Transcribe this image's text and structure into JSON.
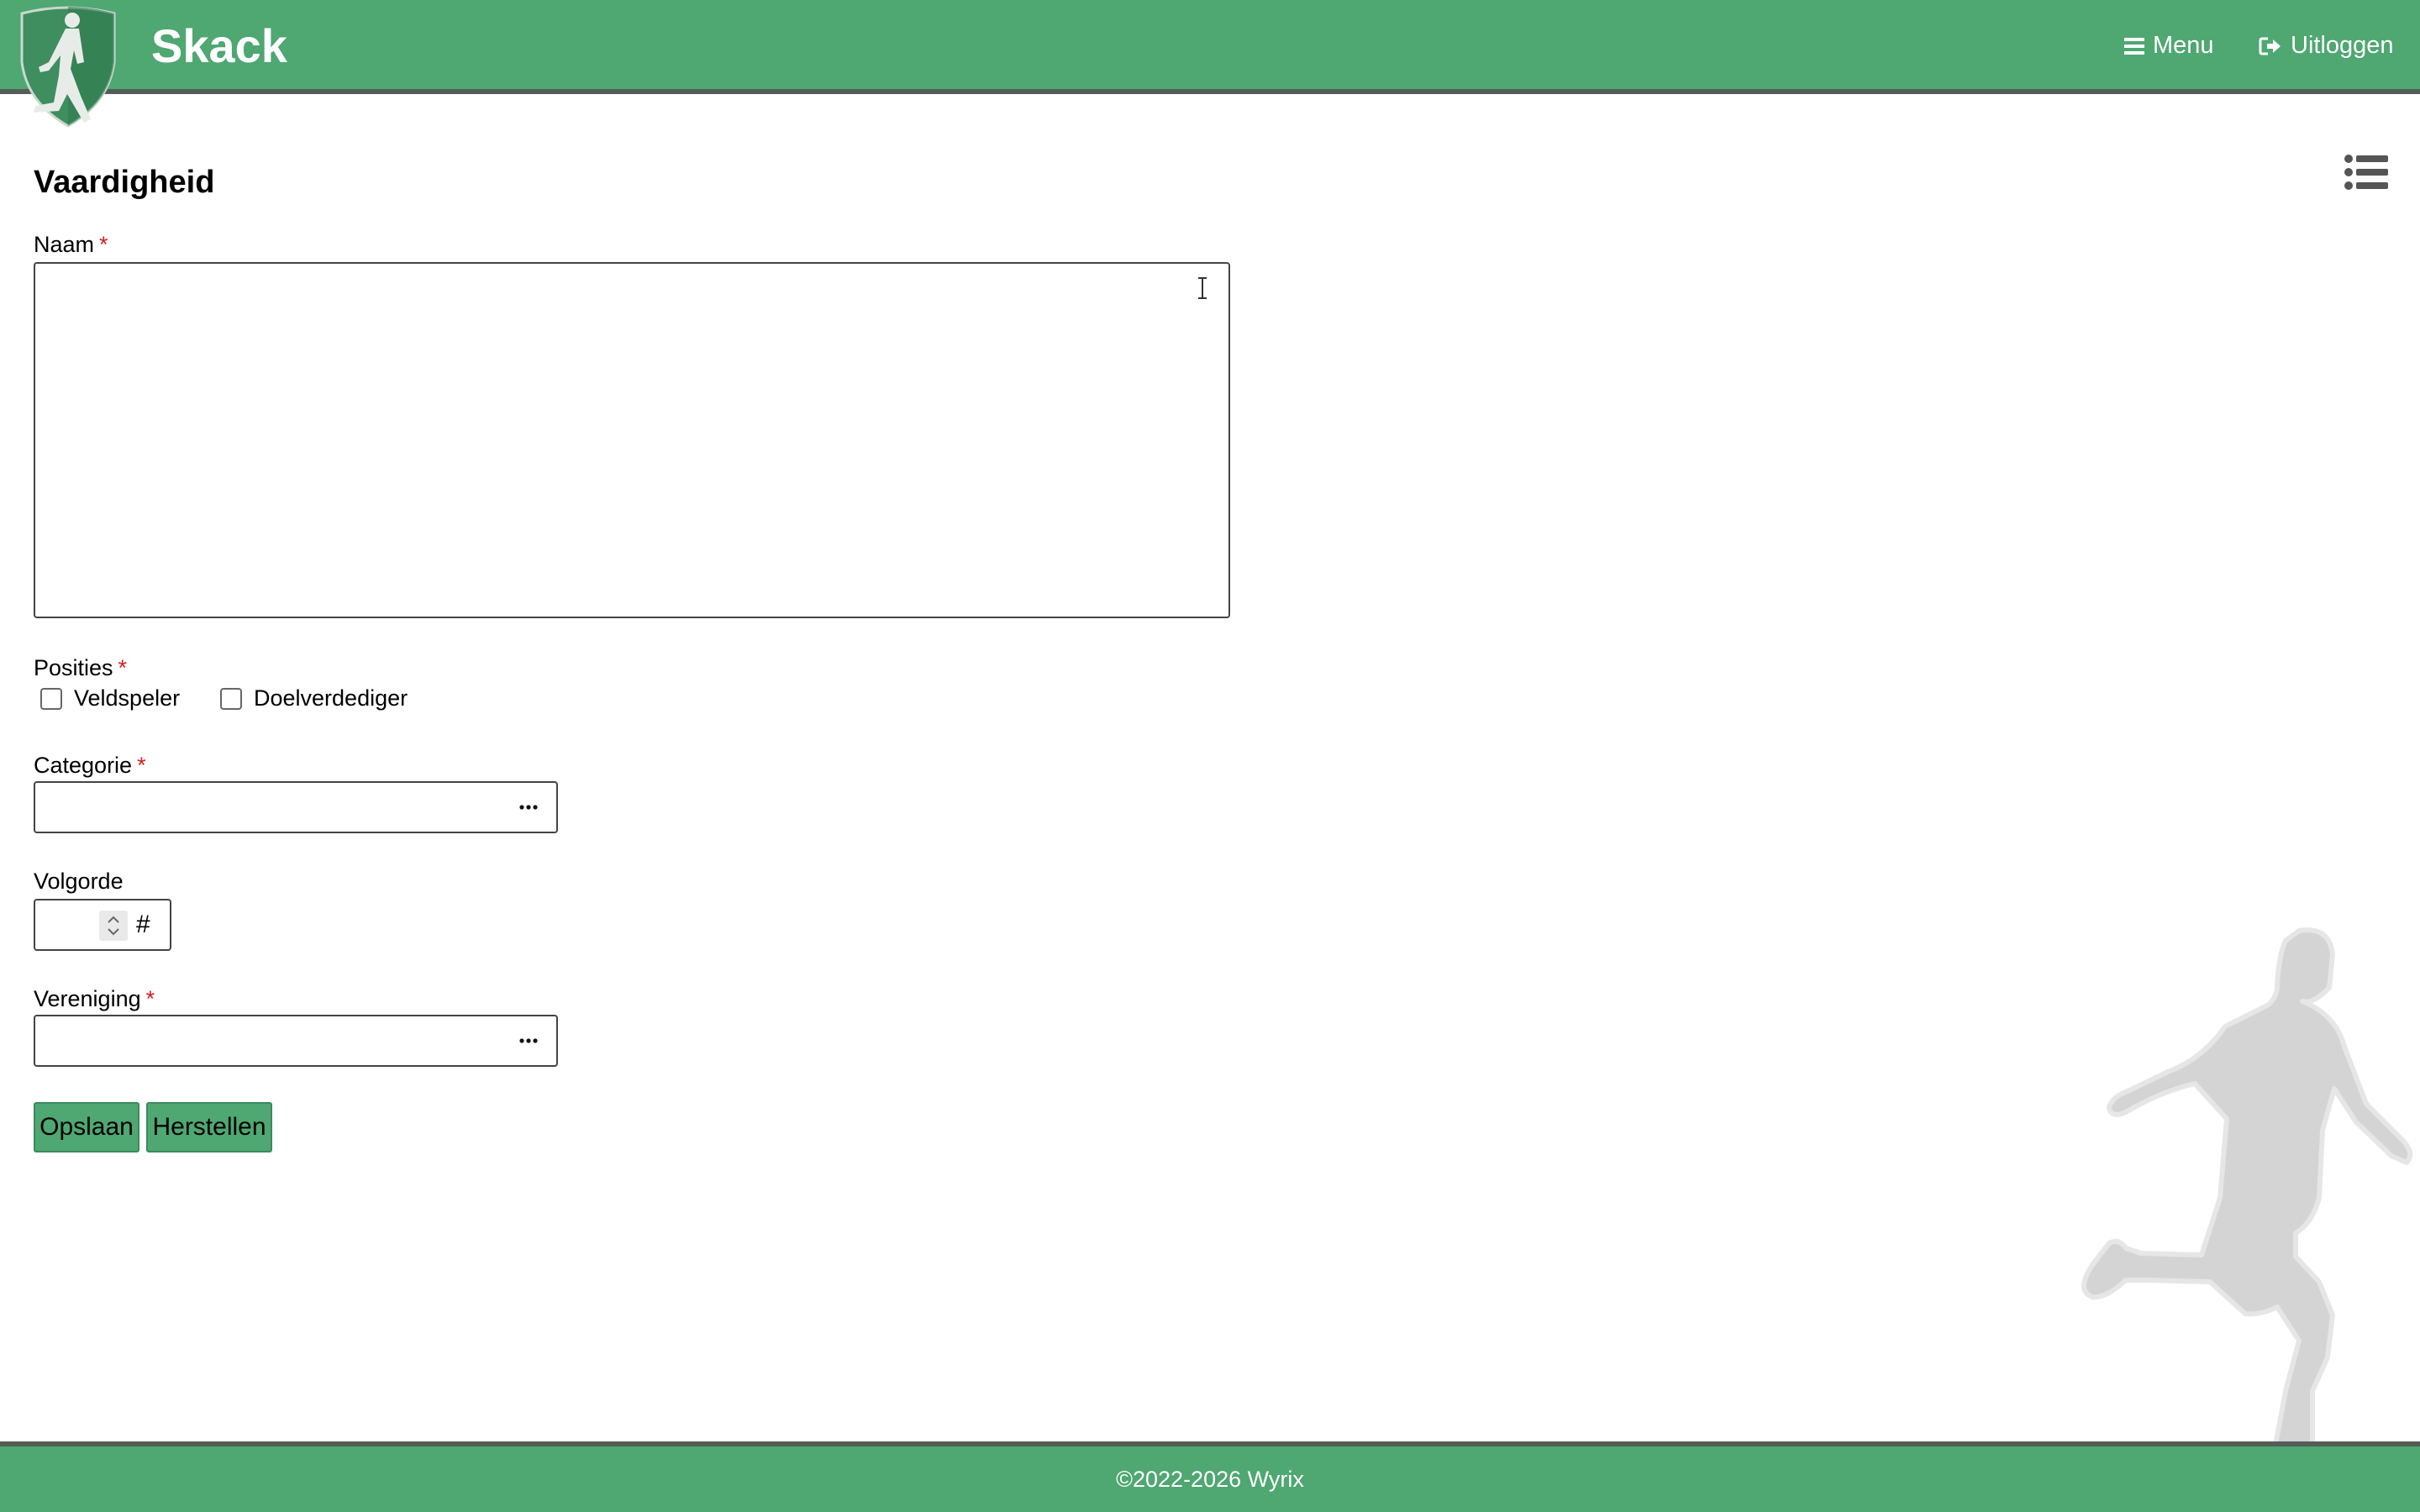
{
  "header": {
    "brand": "Skack",
    "menu_label": "Menu",
    "logout_label": "Uitloggen"
  },
  "page": {
    "title": "Vaardigheid"
  },
  "form": {
    "naam": {
      "label": "Naam",
      "required_mark": "*",
      "value": ""
    },
    "posities": {
      "label": "Posities",
      "required_mark": "*",
      "options": [
        {
          "label": "Veldspeler",
          "checked": false
        },
        {
          "label": "Doelverdediger",
          "checked": false
        }
      ]
    },
    "categorie": {
      "label": "Categorie",
      "required_mark": "*",
      "value": "",
      "lookup_glyph": "•••"
    },
    "volgorde": {
      "label": "Volgorde",
      "value": "",
      "suffix": "#"
    },
    "vereniging": {
      "label": "Vereniging",
      "required_mark": "*",
      "value": "",
      "lookup_glyph": "•••"
    }
  },
  "buttons": {
    "save": "Opslaan",
    "reset": "Herstellen"
  },
  "footer": {
    "copyright": "©2022-2026 Wyrix"
  },
  "colors": {
    "brand_green": "#4fa772",
    "header_border": "#555d58",
    "required_red": "#d21e1e"
  }
}
